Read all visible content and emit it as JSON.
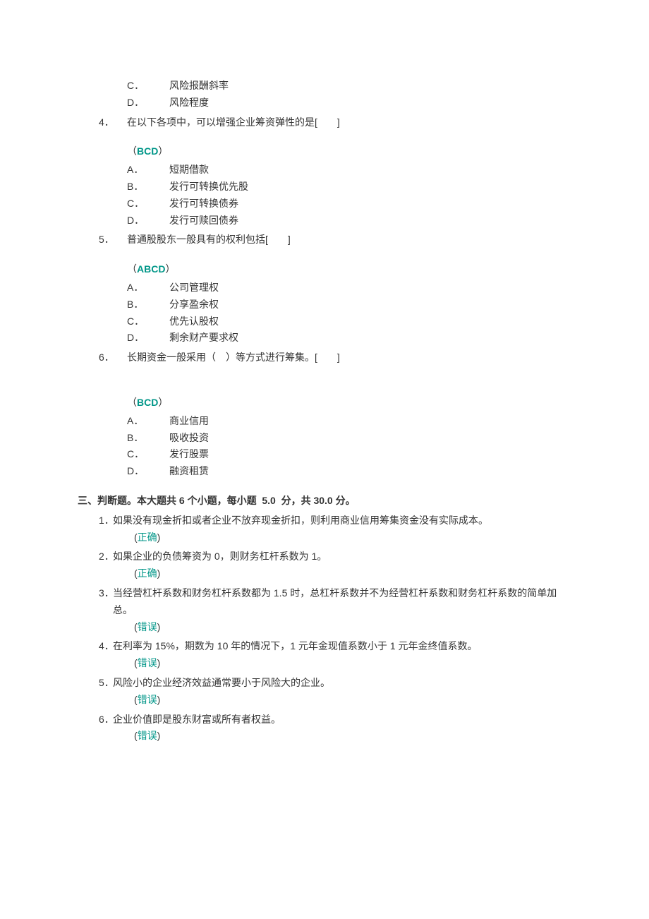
{
  "partial_q3": {
    "options": [
      {
        "letter": "C．",
        "text": "风险报酬斜率"
      },
      {
        "letter": "D．",
        "text": "风险程度"
      }
    ]
  },
  "q4": {
    "num": "4．",
    "stem": "在以下各项中，可以增强企业筹资弹性的是[  ]",
    "answer": "BCD",
    "options": [
      {
        "letter": "A．",
        "text": "短期借款"
      },
      {
        "letter": "B．",
        "text": "发行可转换优先股"
      },
      {
        "letter": "C．",
        "text": "发行可转换债券"
      },
      {
        "letter": "D．",
        "text": "发行可赎回债券"
      }
    ]
  },
  "q5": {
    "num": "5．",
    "stem": "普通股股东一般具有的权利包括[  ]",
    "answer": "ABCD",
    "options": [
      {
        "letter": "A．",
        "text": "公司管理权"
      },
      {
        "letter": "B．",
        "text": "分享盈余权"
      },
      {
        "letter": "C．",
        "text": "优先认股权"
      },
      {
        "letter": "D．",
        "text": "剩余财产要求权"
      }
    ]
  },
  "q6": {
    "num": "6．",
    "stem": "长期资金一般采用（ ）等方式进行筹集。[  ]",
    "answer": "BCD",
    "options": [
      {
        "letter": "A．",
        "text": "商业信用"
      },
      {
        "letter": "B．",
        "text": "吸收投资"
      },
      {
        "letter": "C．",
        "text": "发行股票"
      },
      {
        "letter": "D．",
        "text": "融资租赁"
      }
    ]
  },
  "section3": {
    "title": "三、判断题。本大题共 6 个小题，每小题  5.0  分，共 30.0 分。",
    "items": [
      {
        "num": "1．",
        "stem": "如果没有现金折扣或者企业不放弃现金折扣，则利用商业信用筹集资金没有实际成本。",
        "answer": "正确"
      },
      {
        "num": "2．",
        "stem": "如果企业的负债筹资为 0，则财务杠杆系数为 1。",
        "answer": "正确"
      },
      {
        "num": "3．",
        "stem": "当经营杠杆系数和财务杠杆系数都为 1.5 时，总杠杆系数并不为经营杠杆系数和财务杠杆系数的简单加总。",
        "answer": "错误"
      },
      {
        "num": "4．",
        "stem": "在利率为 15%，期数为 10 年的情况下，1 元年金现值系数小于 1 元年金终值系数。",
        "answer": "错误"
      },
      {
        "num": "5．",
        "stem": "风险小的企业经济效益通常要小于风险大的企业。",
        "answer": "错误"
      },
      {
        "num": "6．",
        "stem": "企业价值即是股东财富或所有者权益。",
        "answer": "错误"
      }
    ]
  }
}
